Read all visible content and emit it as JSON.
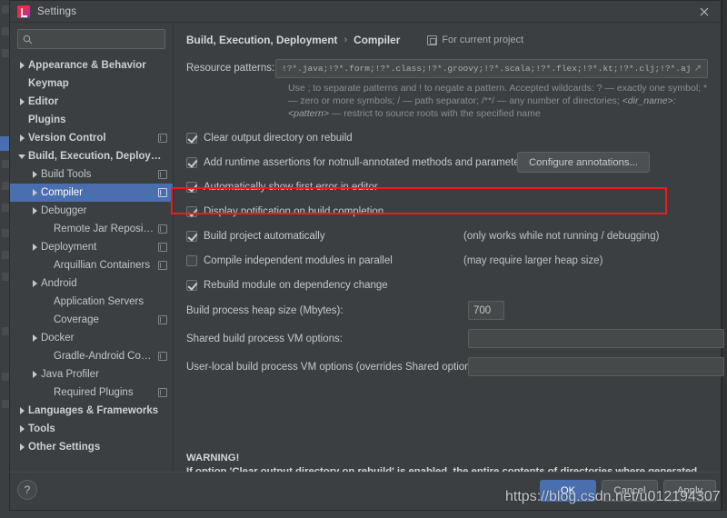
{
  "window": {
    "title": "Settings",
    "logo_icon": "intellij-idea-logo",
    "close_icon": "close-icon"
  },
  "search": {
    "icon": "search-icon",
    "value": "",
    "placeholder": ""
  },
  "sidebar": {
    "items": [
      {
        "label": "Appearance & Behavior",
        "level": 0,
        "arrow": "right",
        "bold": true,
        "badge": false,
        "selected": false
      },
      {
        "label": "Keymap",
        "level": 0,
        "arrow": "none",
        "bold": true,
        "badge": false,
        "selected": false
      },
      {
        "label": "Editor",
        "level": 0,
        "arrow": "right",
        "bold": true,
        "badge": false,
        "selected": false
      },
      {
        "label": "Plugins",
        "level": 0,
        "arrow": "none",
        "bold": true,
        "badge": false,
        "selected": false
      },
      {
        "label": "Version Control",
        "level": 0,
        "arrow": "right",
        "bold": true,
        "badge": true,
        "selected": false
      },
      {
        "label": "Build, Execution, Deployment",
        "level": 0,
        "arrow": "down",
        "bold": true,
        "badge": false,
        "selected": false
      },
      {
        "label": "Build Tools",
        "level": 1,
        "arrow": "right",
        "bold": false,
        "badge": true,
        "selected": false
      },
      {
        "label": "Compiler",
        "level": 1,
        "arrow": "right",
        "bold": false,
        "badge": true,
        "selected": true
      },
      {
        "label": "Debugger",
        "level": 1,
        "arrow": "right",
        "bold": false,
        "badge": false,
        "selected": false
      },
      {
        "label": "Remote Jar Repositories",
        "level": 2,
        "arrow": "none",
        "bold": false,
        "badge": true,
        "selected": false
      },
      {
        "label": "Deployment",
        "level": 1,
        "arrow": "right",
        "bold": false,
        "badge": true,
        "selected": false
      },
      {
        "label": "Arquillian Containers",
        "level": 2,
        "arrow": "none",
        "bold": false,
        "badge": true,
        "selected": false
      },
      {
        "label": "Android",
        "level": 1,
        "arrow": "right",
        "bold": false,
        "badge": false,
        "selected": false
      },
      {
        "label": "Application Servers",
        "level": 2,
        "arrow": "none",
        "bold": false,
        "badge": false,
        "selected": false
      },
      {
        "label": "Coverage",
        "level": 2,
        "arrow": "none",
        "bold": false,
        "badge": true,
        "selected": false
      },
      {
        "label": "Docker",
        "level": 1,
        "arrow": "right",
        "bold": false,
        "badge": false,
        "selected": false
      },
      {
        "label": "Gradle-Android Compiler",
        "level": 2,
        "arrow": "none",
        "bold": false,
        "badge": true,
        "selected": false
      },
      {
        "label": "Java Profiler",
        "level": 1,
        "arrow": "right",
        "bold": false,
        "badge": false,
        "selected": false
      },
      {
        "label": "Required Plugins",
        "level": 2,
        "arrow": "none",
        "bold": false,
        "badge": true,
        "selected": false
      },
      {
        "label": "Languages & Frameworks",
        "level": 0,
        "arrow": "right",
        "bold": true,
        "badge": false,
        "selected": false
      },
      {
        "label": "Tools",
        "level": 0,
        "arrow": "right",
        "bold": true,
        "badge": false,
        "selected": false
      },
      {
        "label": "Other Settings",
        "level": 0,
        "arrow": "right",
        "bold": true,
        "badge": false,
        "selected": false
      }
    ]
  },
  "main": {
    "breadcrumb": {
      "parent": "Build, Execution, Deployment",
      "separator": "›",
      "current": "Compiler"
    },
    "scope": {
      "icon": "project-icon",
      "label": "For current project"
    },
    "resource_patterns": {
      "label": "Resource patterns:",
      "value": "!?*.java;!?*.form;!?*.class;!?*.groovy;!?*.scala;!?*.flex;!?*.kt;!?*.clj;!?*.aj",
      "expand_icon": "expand-icon",
      "hint_part1": "Use ; to separate patterns and ! to negate a pattern. Accepted wildcards: ? — exactly one symbol; * — zero or more symbols; / — path separator; /**/ — any number of directories; ",
      "hint_italic": "<dir_name>:<pattern>",
      "hint_part2": " — restrict to source roots with the specified name"
    },
    "checkboxes": [
      {
        "label": "Clear output directory on rebuild",
        "checked": true,
        "note": "",
        "button": ""
      },
      {
        "label": "Add runtime assertions for notnull-annotated methods and parameters",
        "checked": true,
        "note": "",
        "button": "Configure annotations..."
      },
      {
        "label": "Automatically show first error in editor",
        "checked": true,
        "note": "",
        "button": ""
      },
      {
        "label": "Display notification on build completion",
        "checked": true,
        "note": "",
        "button": ""
      },
      {
        "label": "Build project automatically",
        "checked": true,
        "note": "(only works while not running / debugging)",
        "button": ""
      },
      {
        "label": "Compile independent modules in parallel",
        "checked": false,
        "note": "(may require larger heap size)",
        "button": ""
      },
      {
        "label": "Rebuild module on dependency change",
        "checked": true,
        "note": "",
        "button": ""
      }
    ],
    "fields": [
      {
        "label": "Build process heap size (Mbytes):",
        "value": "700",
        "kind": "heap"
      },
      {
        "label": "Shared build process VM options:",
        "value": "",
        "kind": "vm"
      },
      {
        "label": "User-local build process VM options (overrides Shared options):",
        "value": "",
        "kind": "vm"
      }
    ],
    "warning": {
      "title": "WARNING!",
      "text": "If option 'Clear output directory on rebuild' is enabled, the entire contents of directories where generated sources are stored WILL BE CLEARED on rebuild."
    }
  },
  "footer": {
    "help_label": "?",
    "ok_label": "OK",
    "cancel_label": "Cancel",
    "apply_label": "Apply"
  },
  "overlay": {
    "watermark": "https://blog.csdn.net/u012194307",
    "highlight_color": "#f11a1a"
  }
}
